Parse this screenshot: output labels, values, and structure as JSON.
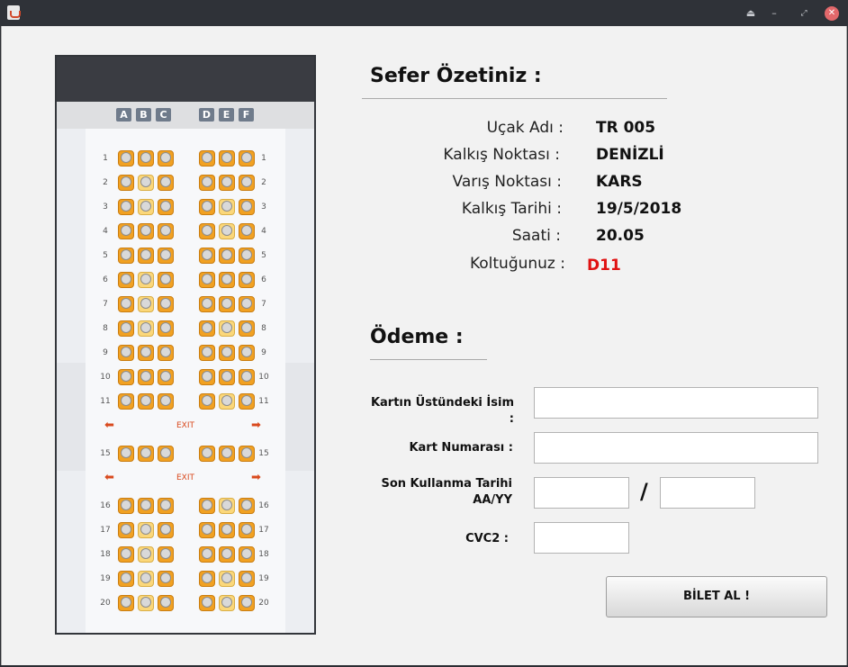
{
  "window": {
    "controls": [
      "eject-icon",
      "minimize-icon",
      "restore-icon",
      "close-icon"
    ]
  },
  "seatmap": {
    "columns_left": [
      "A",
      "B",
      "C"
    ],
    "columns_right": [
      "D",
      "E",
      "F"
    ],
    "exit_label": "EXIT",
    "rows": [
      {
        "num": "1",
        "seats": [
          0,
          0,
          0,
          0,
          0,
          0
        ]
      },
      {
        "num": "2",
        "seats": [
          0,
          1,
          0,
          0,
          0,
          0
        ]
      },
      {
        "num": "3",
        "seats": [
          0,
          1,
          0,
          0,
          1,
          0
        ]
      },
      {
        "num": "4",
        "seats": [
          0,
          0,
          0,
          0,
          1,
          0
        ]
      },
      {
        "num": "5",
        "seats": [
          0,
          0,
          0,
          0,
          0,
          0
        ]
      },
      {
        "num": "6",
        "seats": [
          0,
          1,
          0,
          0,
          0,
          0
        ]
      },
      {
        "num": "7",
        "seats": [
          0,
          1,
          0,
          0,
          0,
          0
        ]
      },
      {
        "num": "8",
        "seats": [
          0,
          1,
          0,
          0,
          1,
          0
        ]
      },
      {
        "num": "9",
        "seats": [
          0,
          0,
          0,
          0,
          0,
          0
        ]
      },
      {
        "num": "10",
        "seats": [
          0,
          0,
          0,
          0,
          0,
          0
        ]
      },
      {
        "num": "11",
        "seats": [
          0,
          0,
          0,
          0,
          1,
          0
        ]
      },
      {
        "exit": true
      },
      {
        "num": "15",
        "seats": [
          0,
          0,
          0,
          0,
          0,
          0
        ]
      },
      {
        "exit": true
      },
      {
        "num": "16",
        "seats": [
          0,
          0,
          0,
          0,
          1,
          0
        ]
      },
      {
        "num": "17",
        "seats": [
          0,
          1,
          0,
          0,
          0,
          0
        ]
      },
      {
        "num": "18",
        "seats": [
          0,
          1,
          0,
          0,
          0,
          0
        ]
      },
      {
        "num": "19",
        "seats": [
          0,
          1,
          0,
          0,
          1,
          0
        ]
      },
      {
        "num": "20",
        "seats": [
          0,
          1,
          0,
          0,
          1,
          0
        ]
      }
    ]
  },
  "summary": {
    "title": "Sefer Özetiniz :",
    "rows": [
      {
        "label": "Uçak Adı :",
        "value": "TR 005"
      },
      {
        "label": "Kalkış Noktası :",
        "value": "DENİZLİ"
      },
      {
        "label": "Varış Noktası :",
        "value": "KARS"
      },
      {
        "label": "Kalkış Tarihi :",
        "value": "19/5/2018"
      },
      {
        "label": "Saati :",
        "value": "20.05"
      },
      {
        "label": "Koltuğunuz :",
        "value": "D11"
      }
    ]
  },
  "payment": {
    "title": "Ödeme :",
    "card_name_label": "Kartın Üstündeki İsim :",
    "card_number_label": "Kart Numarası :",
    "expiry_label_1": "Son Kullanma Tarihi",
    "expiry_label_2": "AA/YY",
    "expiry_separator": "/",
    "cvc_label": "CVC2 :",
    "card_name_value": "",
    "card_number_value": "",
    "expiry_month_value": "",
    "expiry_year_value": "",
    "cvc_value": "",
    "buy_button": "BİLET AL !"
  },
  "colors": {
    "seat_taken": "#f1a122",
    "seat_free": "#fbd77a",
    "selected_seat": "#e01212"
  }
}
